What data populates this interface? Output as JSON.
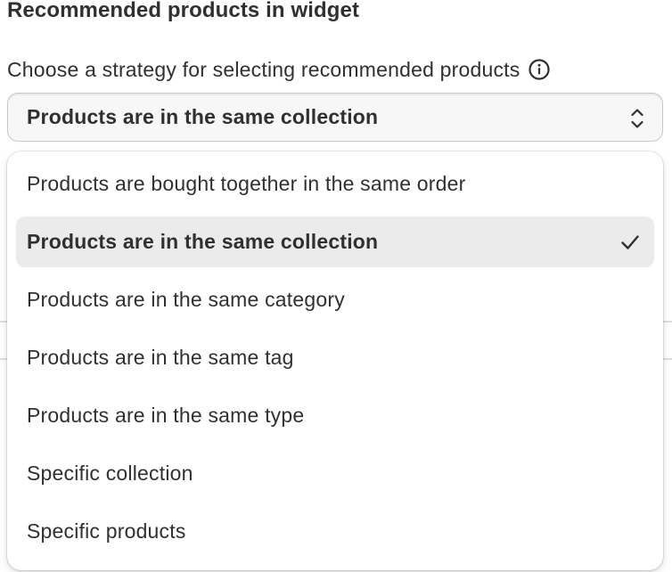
{
  "section": {
    "title": "Recommended products in widget"
  },
  "strategy": {
    "label": "Choose a strategy for selecting recommended products",
    "info_icon": "info-circle-icon",
    "selected_value": "Products are in the same collection",
    "chevron_icon": "chevron-up-down-icon"
  },
  "dropdown": {
    "options": [
      {
        "label": "Products are bought together in the same order",
        "selected": false
      },
      {
        "label": "Products are in the same collection",
        "selected": true
      },
      {
        "label": "Products are in the same category",
        "selected": false
      },
      {
        "label": "Products are in the same tag",
        "selected": false
      },
      {
        "label": "Products are in the same type",
        "selected": false
      },
      {
        "label": "Specific collection",
        "selected": false
      },
      {
        "label": "Specific products",
        "selected": false
      }
    ],
    "check_icon": "checkmark-icon"
  },
  "colors": {
    "text": "#303030",
    "selected_bg": "#ebebeb",
    "select_bg": "#f7f7f7",
    "border": "#c9c9c9"
  }
}
